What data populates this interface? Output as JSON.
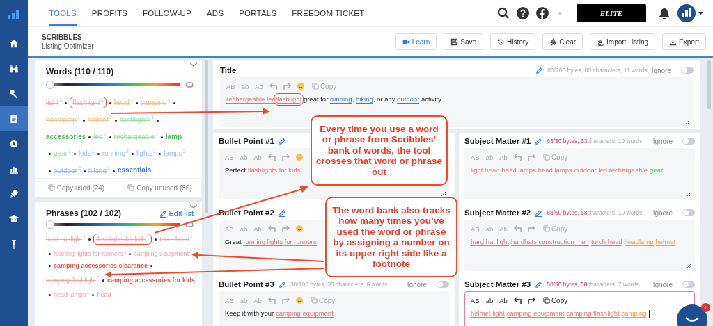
{
  "sidebar": {
    "items": [
      {
        "selected": false
      },
      {
        "selected": false
      },
      {
        "selected": false
      },
      {
        "selected": true
      },
      {
        "selected": false
      },
      {
        "selected": false
      },
      {
        "selected": false
      },
      {
        "selected": false
      },
      {
        "selected": false
      }
    ]
  },
  "nav": {
    "tabs": [
      {
        "label": "TOOLS",
        "selected": true
      },
      {
        "label": "PROFITS",
        "selected": false
      },
      {
        "label": "FOLLOW-UP",
        "selected": false
      },
      {
        "label": "ADS",
        "selected": false
      },
      {
        "label": "PORTALS",
        "selected": false
      },
      {
        "label": "FREEDOM TICKET",
        "selected": false
      }
    ],
    "plan": "ELITE"
  },
  "header": {
    "title": "SCRIBBLES",
    "subtitle": "Listing Optimizer",
    "buttons": [
      {
        "label": "Learn",
        "kind": "primary"
      },
      {
        "label": "Save",
        "kind": "save"
      },
      {
        "label": "History",
        "kind": "history"
      },
      {
        "label": "Clear",
        "kind": "clear"
      },
      {
        "label": "Import Listing",
        "kind": "import"
      },
      {
        "label": "Export",
        "kind": "export"
      }
    ]
  },
  "words": {
    "title": "Words (110 / 110)",
    "level": 0,
    "items": [
      {
        "text": "light",
        "count": "3",
        "color": "#f2a3a3",
        "used": true
      },
      {
        "text": "flashlight",
        "count": "2",
        "color": "#f2a3a3",
        "used": true,
        "circled": true
      },
      {
        "text": "head",
        "count": "3",
        "color": "#f5c08a",
        "used": true
      },
      {
        "text": "camping",
        "count": "4",
        "color": "#f5c08a",
        "used": true
      },
      {
        "text": "headlamp",
        "count": "1",
        "color": "#f5c08a",
        "used": true
      },
      {
        "text": "helmet",
        "count": "2",
        "color": "#f5c08a",
        "used": true
      },
      {
        "text": "flashlights",
        "count": "1",
        "color": "#9fdca8",
        "used": true
      },
      {
        "text": "accessories",
        "color": "#4cbb5c",
        "used": false
      },
      {
        "text": "led",
        "count": "2",
        "color": "#9fdca8",
        "used": true
      },
      {
        "text": "rechargeable",
        "count": "2",
        "color": "#9fdca8",
        "used": true
      },
      {
        "text": "lamp",
        "color": "#4cbb5c",
        "used": false
      },
      {
        "text": "gear",
        "count": "1",
        "color": "#9fdca8",
        "used": true
      },
      {
        "text": "kids",
        "count": "1",
        "color": "#9bbcf0",
        "used": true
      },
      {
        "text": "running",
        "count": "2",
        "color": "#9bbcf0",
        "used": true
      },
      {
        "text": "lights",
        "count": "1",
        "color": "#9bbcf0",
        "used": true
      },
      {
        "text": "lamps",
        "count": "2",
        "color": "#9bbcf0",
        "used": true
      },
      {
        "text": "outdoor",
        "count": "2",
        "color": "#9bbcf0",
        "used": true
      },
      {
        "text": "hiking",
        "count": "1",
        "color": "#9bbcf0",
        "used": true
      },
      {
        "text": "essentials",
        "color": "#3b7be0",
        "used": false
      }
    ],
    "copy_used": "Copy used (24)",
    "copy_unused": "Copy unused (86)"
  },
  "phrases": {
    "title": "Phrases (102 / 102)",
    "edit": "Edit list",
    "level": 0,
    "items": [
      {
        "text": "hard hat light",
        "count": "1",
        "color": "#f2a3a3",
        "used": true
      },
      {
        "text": "flashlights for kids",
        "count": "1",
        "color": "#f2a3a3",
        "used": true,
        "circled": true
      },
      {
        "text": "torch head",
        "count": "1",
        "color": "#f2a3a3",
        "used": true
      },
      {
        "text": "running lights for runners",
        "count": "1",
        "color": "#f2a3a3",
        "used": true
      },
      {
        "text": "camping equipment",
        "count": "2",
        "color": "#f2a3a3",
        "used": true
      },
      {
        "text": "camping accessories clearance",
        "color": "#e8504f",
        "used": false
      },
      {
        "text": "camping flashlight",
        "count": "1",
        "color": "#f2a3a3",
        "used": true
      },
      {
        "text": "camping accessories for kids",
        "color": "#e8504f",
        "used": false
      },
      {
        "text": "head lamps",
        "count": "1",
        "color": "#f2a3a3",
        "used": true
      },
      {
        "text": "head",
        "color": "#f2a3a3",
        "used": true
      }
    ]
  },
  "title_field": {
    "label": "Title",
    "stats": [
      {
        "text": "80/200 bytes, 80 characters, 11 words",
        "alert": false
      }
    ],
    "ignore": "Ignore",
    "on": false,
    "focused": false,
    "tools": [
      "AB",
      "ab",
      "Ab"
    ],
    "emoji": true,
    "copy": "Copy",
    "segments": [
      {
        "text": "rechargeable led",
        "color": "#e57373"
      },
      {
        "text": "flashlight",
        "color": "#e57373",
        "circled": true
      },
      {
        "text": " great for "
      },
      {
        "text": "running",
        "color": "#3b7be0"
      },
      {
        "text": ", "
      },
      {
        "text": "hiking",
        "color": "#3b7be0"
      },
      {
        "text": ", or any "
      },
      {
        "text": "outdoor",
        "color": "#3b7be0"
      },
      {
        "text": " activity."
      }
    ]
  },
  "bullets": [
    {
      "label": "Bullet Point #1",
      "focused": false,
      "tools": [
        "AB",
        "ab",
        "Ab"
      ],
      "emoji": true,
      "segments": [
        {
          "text": "Perfect "
        },
        {
          "text": "flashlights for kids",
          "color": "#e57373"
        }
      ]
    },
    {
      "label": "Bullet Point #2",
      "focused": false,
      "tools": [
        "AB",
        "ab",
        "Ab"
      ],
      "emoji": true,
      "segments": [
        {
          "text": "Great "
        },
        {
          "text": "running lights for runners",
          "color": "#e57373"
        }
      ]
    },
    {
      "label": "Bullet Point #3",
      "stats": [
        {
          "text": "36/100 bytes, 36 characters, 6 words",
          "alert": false
        }
      ],
      "ignore": "Ignore",
      "on": false,
      "focused": false,
      "tools": [
        "AB",
        "ab",
        "Ab"
      ],
      "emoji": true,
      "copy": "Copy",
      "segments": [
        {
          "text": "Keep it with your "
        },
        {
          "text": "camping equipment",
          "color": "#e57373"
        }
      ]
    }
  ],
  "subjects": [
    {
      "label": "Subject Matter #1",
      "stats": [
        {
          "text": "63/50 bytes, 63",
          "alert": true
        },
        {
          "text": "characters, 10 words",
          "alert": false
        }
      ],
      "ignore": "Ignore",
      "on": false,
      "focused": false,
      "tools": [
        "AB",
        "ab",
        "Ab"
      ],
      "copy": "Copy",
      "segments": [
        {
          "text": "light",
          "color": "#e57373"
        },
        {
          "text": "head",
          "color": "#f0a04b"
        },
        {
          "text": "head lamps",
          "color": "#e57373"
        },
        {
          "text": "head lamps outdoor led rechargeable",
          "color": "#e57373"
        },
        {
          "text": "gear",
          "color": "#4cbb5c"
        }
      ]
    },
    {
      "label": "Subject Matter #2",
      "stats": [
        {
          "text": "68/50 bytes, 68",
          "alert": true
        },
        {
          "text": "characters, 10 words",
          "alert": false
        }
      ],
      "ignore": "Ignore",
      "on": false,
      "focused": false,
      "tools": [
        "AB",
        "ab",
        "Ab"
      ],
      "copy": "Copy",
      "segments": [
        {
          "text": "hard hat light",
          "color": "#e57373"
        },
        {
          "text": "hardhats construction men",
          "color": "#e57373"
        },
        {
          "text": "torch head",
          "color": "#e57373"
        },
        {
          "text": "headlamp",
          "color": "#f0a04b"
        },
        {
          "text": "helmet",
          "color": "#f0a04b"
        }
      ]
    },
    {
      "label": "Subject Matter #3",
      "stats": [
        {
          "text": "58/50 bytes, 58",
          "alert": true
        },
        {
          "text": "characters, 7 words",
          "alert": false
        }
      ],
      "ignore": "Ignore",
      "on": false,
      "focused": true,
      "tools": [
        "AB",
        "ab",
        "Ab"
      ],
      "copy": "Copy",
      "segments": [
        {
          "text": "helmet light",
          "color": "#e57373"
        },
        {
          "text": "camping equipment",
          "color": "#e57373"
        },
        {
          "text": "camping flashlight",
          "color": "#e57373"
        },
        {
          "text": "camping",
          "color": "#f0a04b"
        }
      ]
    }
  ],
  "callouts": [
    {
      "text": "Every time you use a word or phrase from Scribbles’ bank of words, the tool crosses that word or phrase out"
    },
    {
      "text": "The word bank also tracks how many times you’ve used the word or phrase by assigning a number on its upper right side like a footnote"
    }
  ],
  "chat": {
    "badge": "1"
  }
}
